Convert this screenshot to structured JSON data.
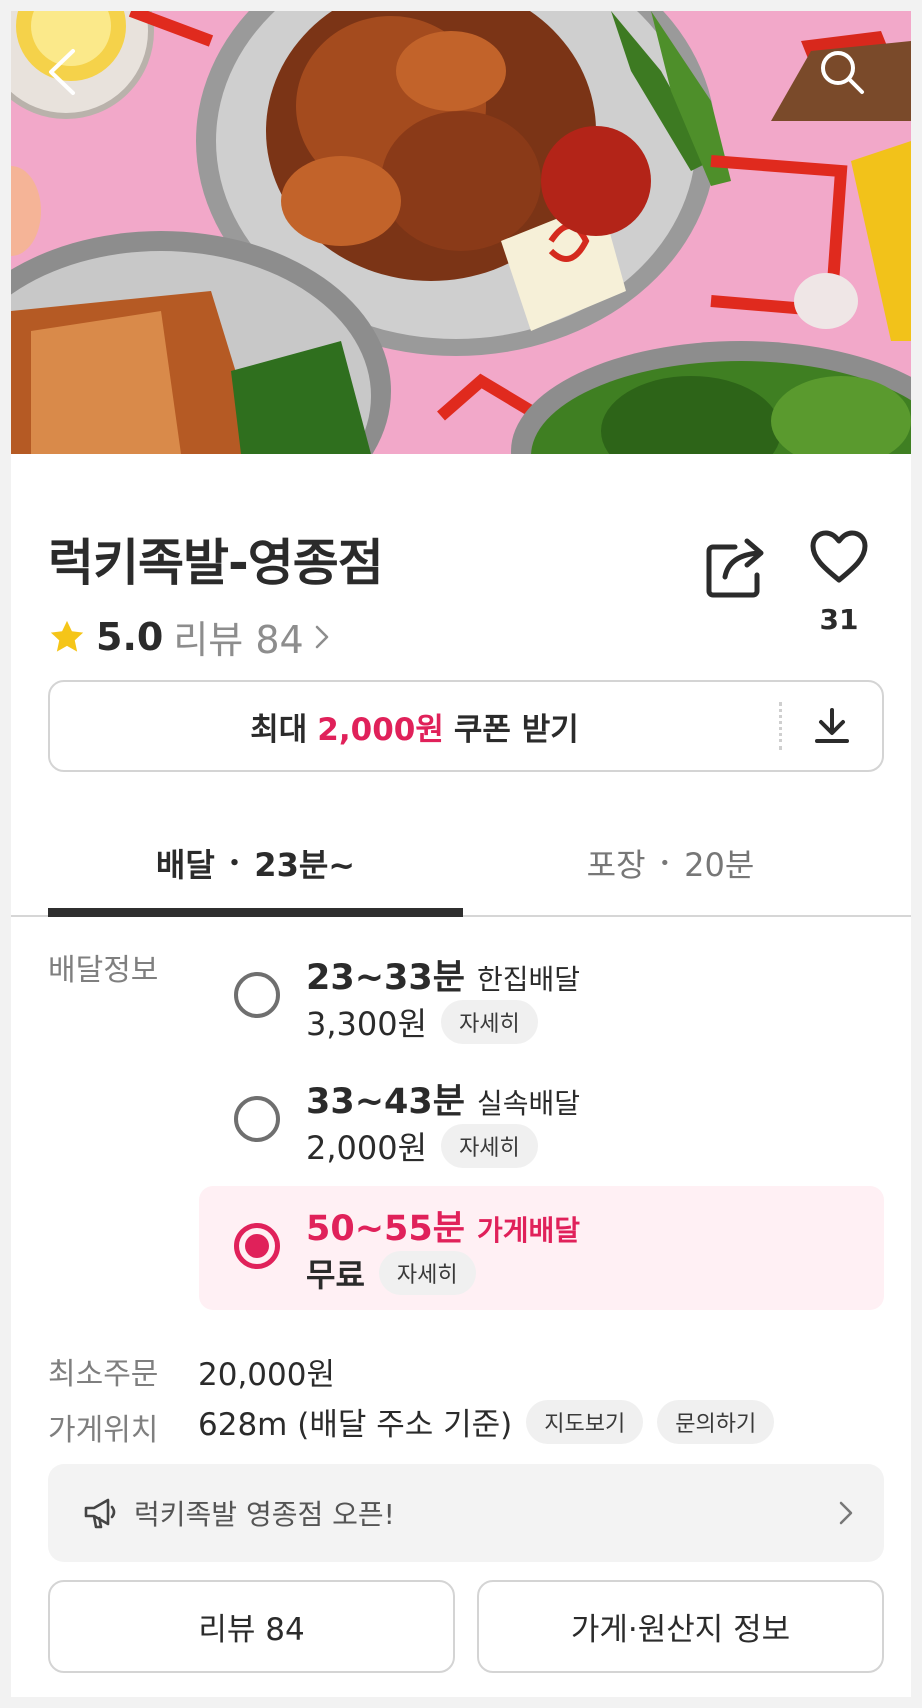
{
  "hero": {
    "image_alt": "족발 요리 사진"
  },
  "store": {
    "name": "럭키족발-영종점",
    "rating": "5.0",
    "review_label": "리뷰 84",
    "like_count": "31"
  },
  "coupon": {
    "prefix": "최대",
    "amount": "2,000원",
    "suffix": "쿠폰 받기"
  },
  "tabs": [
    {
      "label": "배달",
      "time": "23분~"
    },
    {
      "label": "포장",
      "time": "20분"
    }
  ],
  "delivery": {
    "section_label": "배달정보",
    "options": [
      {
        "time": "23~33분",
        "kind": "한집배달",
        "fee": "3,300원",
        "detail": "자세히",
        "selected": false
      },
      {
        "time": "33~43분",
        "kind": "실속배달",
        "fee": "2,000원",
        "detail": "자세히",
        "selected": false
      },
      {
        "time": "50~55분",
        "kind": "가게배달",
        "fee": "무료",
        "detail": "자세히",
        "selected": true
      }
    ]
  },
  "min_order": {
    "label": "최소주문",
    "value": "20,000원"
  },
  "location": {
    "label": "가게위치",
    "value": "628m (배달 주소 기준)",
    "map_button": "지도보기",
    "inquiry_button": "문의하기"
  },
  "notice": {
    "text": "럭키족발 영종점 오픈!"
  },
  "bottom_buttons": {
    "reviews": "리뷰 84",
    "store_info": "가게·원산지 정보"
  },
  "colors": {
    "accent": "#e0215a",
    "star": "#f5c518",
    "selected_bg": "#fff0f4"
  },
  "icons": [
    "back-arrow-icon",
    "search-icon",
    "share-icon",
    "heart-icon",
    "star-icon",
    "chevron-right-icon",
    "download-icon",
    "megaphone-icon"
  ]
}
